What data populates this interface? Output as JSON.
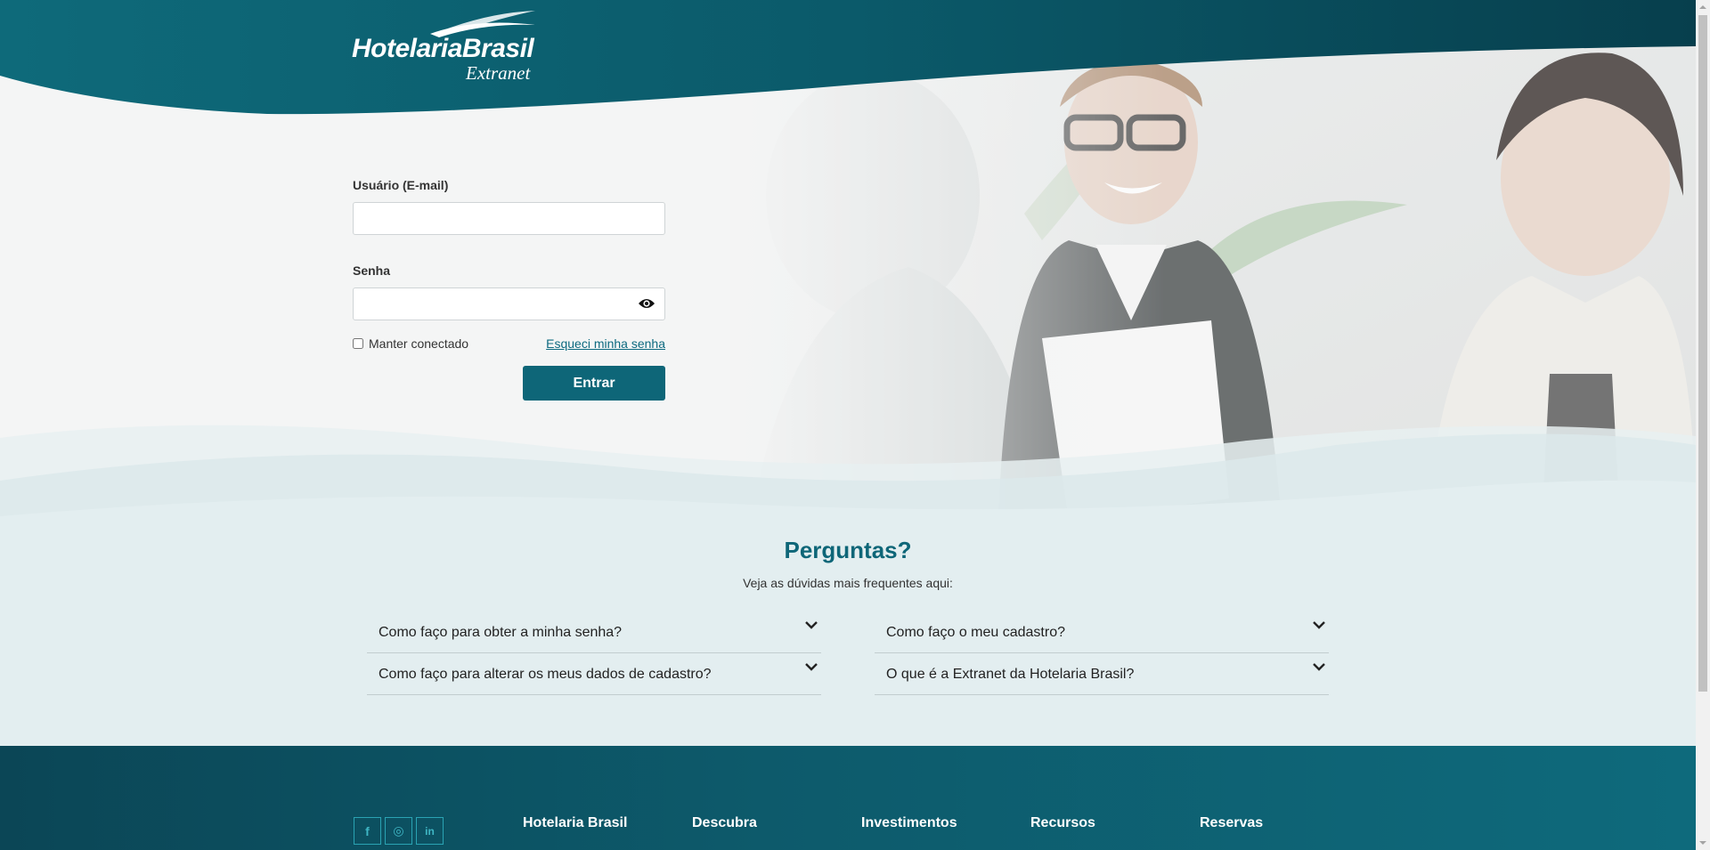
{
  "brand": {
    "name": "HotelariaBrasil",
    "product": "Extranet"
  },
  "login": {
    "user_label": "Usuário (E-mail)",
    "user_value": "",
    "password_label": "Senha",
    "password_value": "",
    "remember_label": "Manter conectado",
    "forgot_label": "Esqueci minha senha",
    "submit_label": "Entrar"
  },
  "faq": {
    "title": "Perguntas?",
    "subtitle": "Veja as dúvidas mais frequentes aqui:",
    "items": [
      {
        "question": "Como faço para obter a minha senha?"
      },
      {
        "question": "Como faço o meu cadastro?"
      },
      {
        "question": "Como faço para alterar os meus dados de cadastro?"
      },
      {
        "question": "O que é a Extranet da Hotelaria Brasil?"
      }
    ]
  },
  "footer": {
    "social": [
      {
        "icon": "facebook-icon",
        "glyph": "f"
      },
      {
        "icon": "instagram-icon",
        "glyph": "◎"
      },
      {
        "icon": "linkedin-icon",
        "glyph": "in"
      }
    ],
    "columns": [
      "Hotelaria Brasil",
      "Descubra",
      "Investimentos",
      "Recursos",
      "Reservas"
    ]
  },
  "colors": {
    "primary": "#0e6678",
    "header_dark": "#0b4656",
    "faq_bg": "#e3eef0",
    "page_bg": "#f4f5f5"
  }
}
